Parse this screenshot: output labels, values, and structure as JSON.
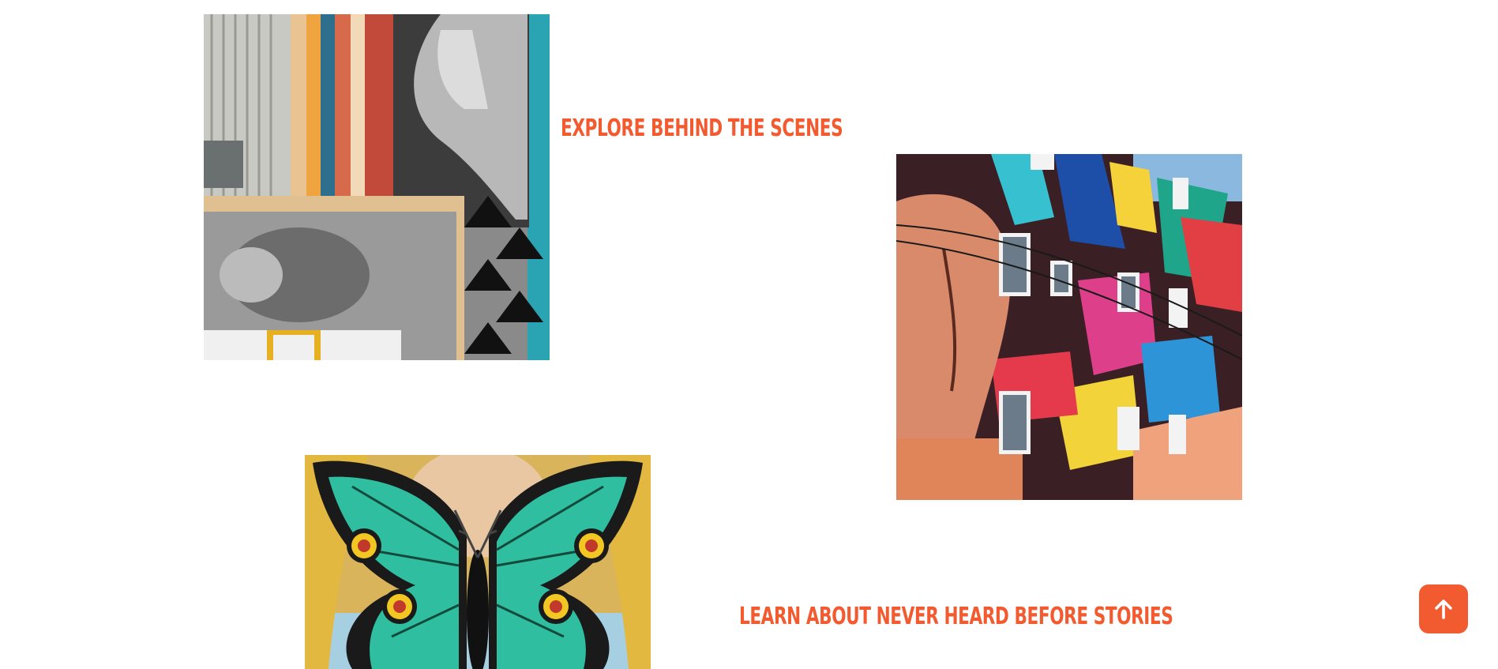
{
  "colors": {
    "accent": "#f25a30",
    "background": "#ffffff"
  },
  "images": {
    "mural_portrait_alt": "mural-portrait-photo",
    "mural_building_alt": "mural-building-photo",
    "mural_butterfly_alt": "mural-butterfly-photo"
  },
  "headings": {
    "explore": "EXPLORE BEHIND THE SCENES",
    "stories": "LEARN ABOUT NEVER HEARD BEFORE STORIES"
  },
  "scroll_top": {
    "icon": "arrow-up-icon"
  }
}
